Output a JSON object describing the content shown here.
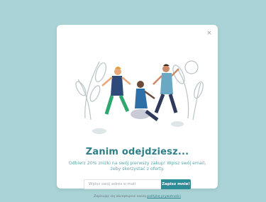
{
  "modal": {
    "close_label": "×",
    "title": "Zanim odejdziesz...",
    "subtitle": "Odbierz 20% zniżki na swój pierwszy zakup! Wpisz swój email, żeby skorzystać z oferty.",
    "email_placeholder": "Wpisz swój adres e-mail",
    "submit_label": "Zapisz mnie!",
    "consent_text": "Zapisując się akceptujesz naszą",
    "consent_link": "politykę prywatności",
    "illustration_icon": "people-dancing-plants-illustration"
  },
  "colors": {
    "background": "#a9d3d6",
    "accent": "#2e8c96",
    "title": "#2e7f87"
  }
}
